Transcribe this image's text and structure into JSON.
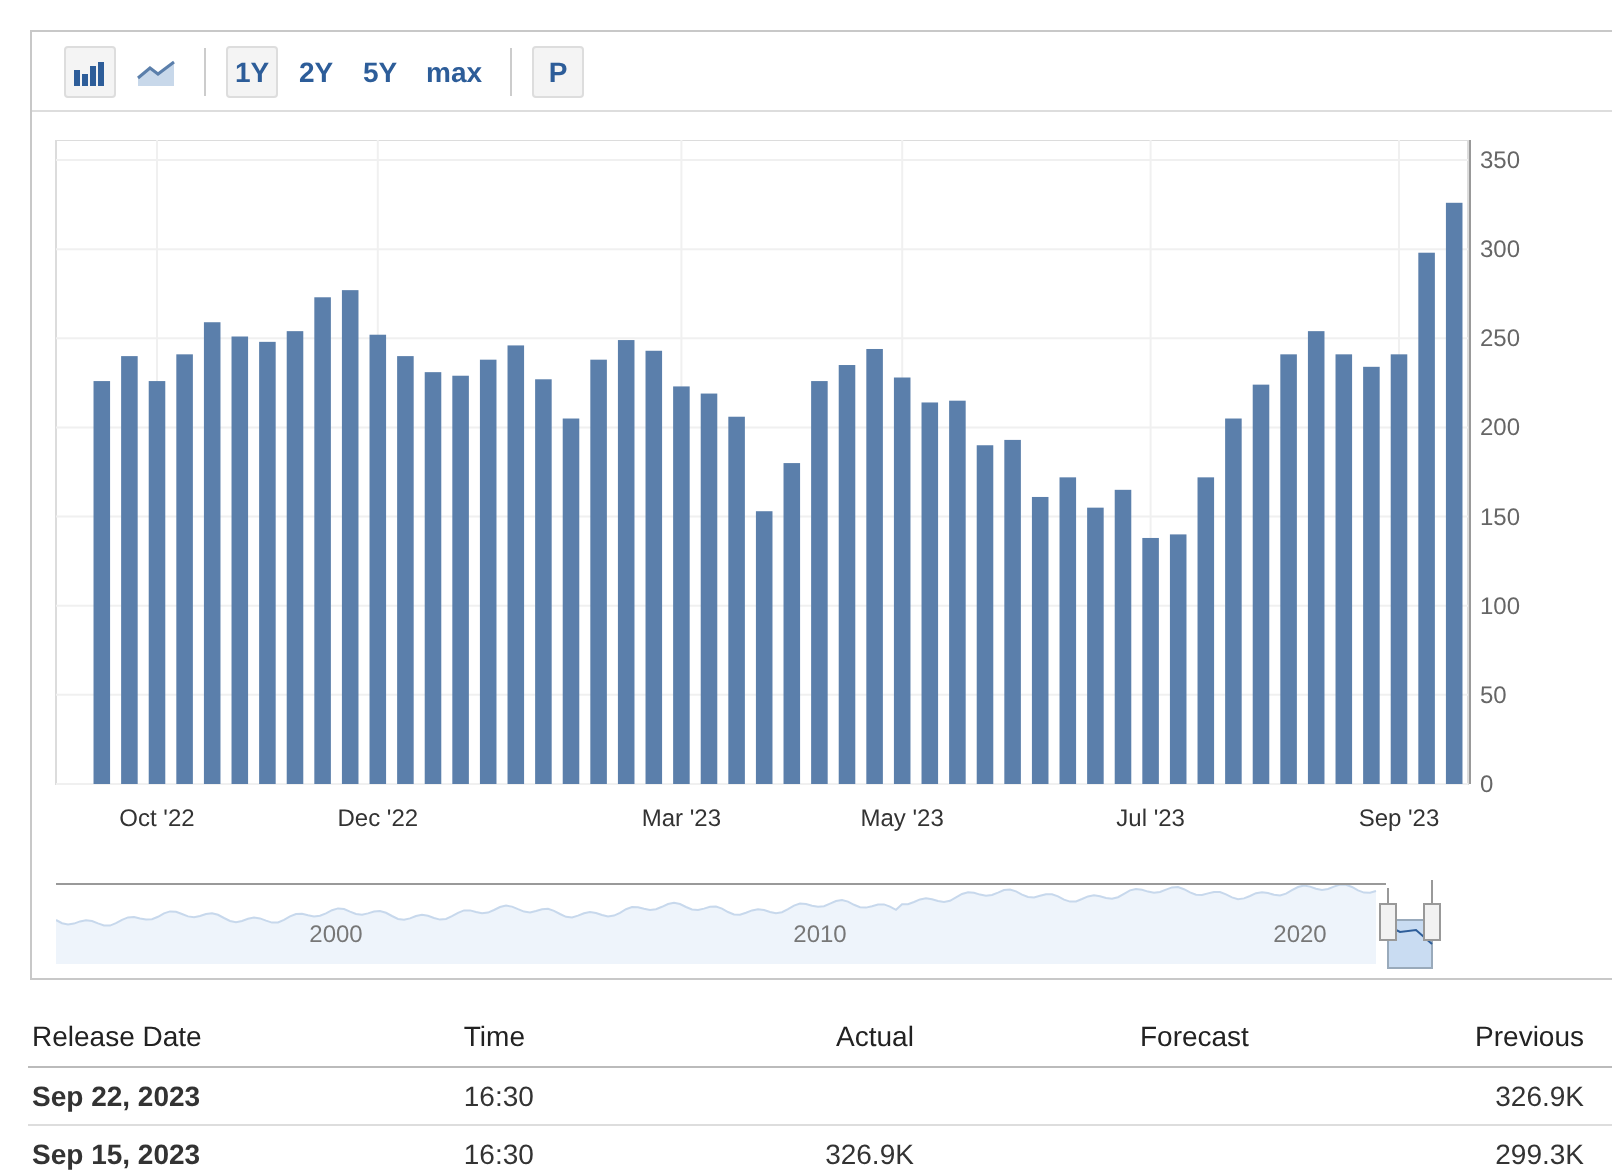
{
  "toolbar": {
    "chart_types": [
      {
        "kind": "bar",
        "selected": true
      },
      {
        "kind": "line",
        "selected": false
      }
    ],
    "ranges": [
      {
        "label": "1Y",
        "selected": true
      },
      {
        "label": "2Y",
        "selected": false
      },
      {
        "label": "5Y",
        "selected": false
      },
      {
        "label": "max",
        "selected": false
      }
    ],
    "extra": {
      "label": "P"
    }
  },
  "chart": {
    "x_labels": [
      "Oct '22",
      "Dec '22",
      "Mar '23",
      "May '23",
      "Jul '23",
      "Sep '23"
    ],
    "chart_data": {
      "type": "bar",
      "grid": true,
      "ylim": [
        0,
        350
      ],
      "yticks": [
        0,
        50,
        100,
        150,
        200,
        250,
        300,
        350
      ],
      "series": [
        {
          "color": "#5b7fab",
          "values": [
            226,
            240,
            226,
            241,
            259,
            251,
            248,
            254,
            273,
            277,
            252,
            240,
            231,
            229,
            238,
            246,
            227,
            205,
            238,
            249,
            243,
            223,
            219,
            206,
            153,
            180,
            226,
            235,
            244,
            228,
            214,
            215,
            190,
            193,
            161,
            172,
            155,
            165,
            138,
            140,
            172,
            205,
            224,
            241,
            254,
            241,
            234,
            241,
            298,
            326
          ]
        }
      ]
    }
  },
  "navigator": {
    "labels": [
      "2000",
      "2010",
      "2020"
    ]
  },
  "table": {
    "columns": [
      "Release Date",
      "Time",
      "Actual",
      "Forecast",
      "Previous"
    ],
    "rows": [
      [
        "Sep 22, 2023",
        "16:30",
        "",
        "",
        "326.9K"
      ],
      [
        "Sep 15, 2023",
        "16:30",
        "326.9K",
        "",
        "299.3K"
      ]
    ]
  }
}
